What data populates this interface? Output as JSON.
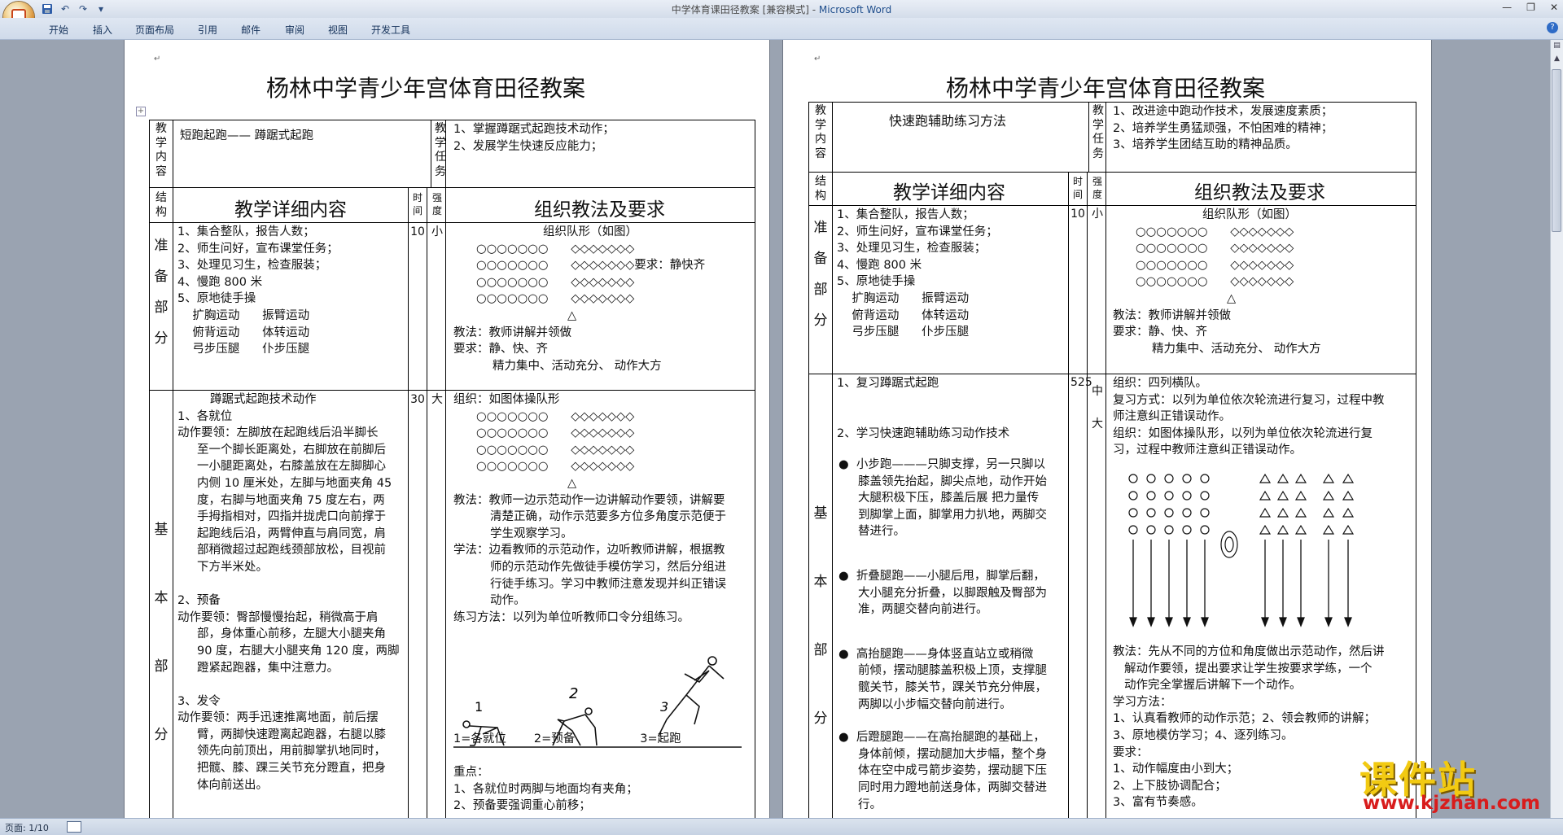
{
  "window": {
    "title_doc": "中学体育课田径教案 [兼容模式] - ",
    "title_app": "Microsoft Word"
  },
  "ribbon_tabs": [
    "开始",
    "插入",
    "页面布局",
    "引用",
    "邮件",
    "审阅",
    "视图",
    "开发工具"
  ],
  "status": {
    "page": "页面: 1/10"
  },
  "watermark": {
    "cn": "课件站",
    "url": "www.kjzhan.com"
  },
  "page1": {
    "title": "杨林中学青少年宫体育田径教案",
    "lbl_content": "教学内容",
    "lbl_task": "教学任务",
    "content": "短跑起跑—— 蹲踞式起跑",
    "tasks": [
      "1、掌握蹲踞式起跑技术动作；",
      "2、发展学生快速反应能力；"
    ],
    "lbl_struct": "结构",
    "hdr_detail": "教学详细内容",
    "lbl_time": "时间",
    "lbl_intensity": "强度",
    "hdr_org": "组织教法及要求",
    "sec1_label": "准备部分",
    "sec1_items": [
      "1、集合整队，报告人数；",
      "2、师生问好，宣布课堂任务；",
      "3、处理见习生，检查服装；",
      "4、慢跑 800 米",
      "5、原地徒手操",
      "    扩胸运动      振臂运动",
      "    俯背运动      体转运动",
      "    弓步压腿      仆步压腿"
    ],
    "sec1_time": "10",
    "sec1_int": "小",
    "sec1_org": [
      "组织队形（如图）",
      "○○○○○○○      ◇◇◇◇◇◇◇",
      "○○○○○○○      ◇◇◇◇◇◇◇要求：静快齐",
      "○○○○○○○      ◇◇◇◇◇◇◇",
      "○○○○○○○      ◇◇◇◇◇◇◇",
      "△",
      "教法：教师讲解并领做",
      "要求：静、快、齐",
      "精力集中、活动充分、  动作大方"
    ],
    "sec2_label": "基本部分",
    "sec2_items": [
      "蹲踞式起跑技术动作",
      "1、各就位",
      "动作要领：左脚放在起跑线后沿半脚长",
      "至一个脚长距离处，右脚放在前脚后",
      "一小腿距离处，右膝盖放在左脚脚心",
      "内侧 10 厘米处，左脚与地面夹角 45",
      "度，右脚与地面夹角 75 度左右，两",
      "手拇指相对，四指并拢虎口向前撑于",
      "起跑线后沿，两臂伸直与肩同宽，肩",
      "部稍微超过起跑线颈部放松，目视前",
      "下方半米处。",
      "",
      "2、预备",
      "动作要领：臀部慢慢抬起，稍微高于肩",
      "部，身体重心前移，左腿大小腿夹角",
      "90 度，右腿大小腿夹角 120 度，两脚",
      "蹬紧起跑器，集中注意力。",
      "",
      "3、发令",
      "动作要领：两手迅速推离地面，前后摆",
      "臂，两脚快速蹬离起跑器，右腿以膝",
      "领先向前顶出，用前脚掌扒地同时，",
      "把髋、膝、踝三关节充分蹬直，把身",
      "体向前送出。"
    ],
    "sec2_time": "30",
    "sec2_int": "大",
    "sec2_org": [
      "组织：如图体操队形",
      "○○○○○○○      ◇◇◇◇◇◇◇",
      "○○○○○○○      ◇◇◇◇◇◇◇",
      "○○○○○○○      ◇◇◇◇◇◇◇",
      "○○○○○○○      ◇◇◇◇◇◇◇",
      "△",
      "教法：教师一边示范动作一边讲解动作要领，讲解要",
      "清楚正确，动作示范要多方位多角度示范便于",
      "学生观察学习。",
      "学法：边看教师的示范动作，边听教师讲解，根据教",
      "师的示范动作先做徒手模仿学习，然后分组进",
      "行徒手练习。学习中教师注意发现并纠正错误",
      "动作。",
      "练习方法：以列为单位听教师口令分组练习。"
    ],
    "fig_nums": [
      "1",
      "2",
      "3"
    ],
    "fig_caption": [
      "1=各就位",
      "2=预备",
      "3=起跑"
    ],
    "points_title": "重点：",
    "points": [
      "1、各就位时两脚与地面均有夹角；",
      "2、预备要强调重心前移；"
    ]
  },
  "page2": {
    "title": "杨林中学青少年宫体育田径教案",
    "lbl_content": "教学内容",
    "lbl_task": "教学任务",
    "content": "快速跑辅助练习方法",
    "tasks": [
      "1、改进途中跑动作技术，发展速度素质；",
      "2、培养学生勇猛顽强，不怕困难的精神；",
      "3、培养学生团结互助的精神品质。"
    ],
    "lbl_struct": "结构",
    "hdr_detail": "教学详细内容",
    "lbl_time": "时间",
    "lbl_intensity": "强度",
    "hdr_org": "组织教法及要求",
    "sec1_label": "准备部分",
    "sec1_items": [
      "1、集合整队，报告人数；",
      "2、师生问好，宣布课堂任务；",
      "3、处理见习生，检查服装；",
      "4、慢跑 800 米",
      "5、原地徒手操",
      "    扩胸运动      振臂运动",
      "    俯背运动      体转运动",
      "    弓步压腿      仆步压腿"
    ],
    "sec1_time": "10",
    "sec1_int": "小",
    "sec1_org": [
      "组织队形（如图）",
      "○○○○○○○      ◇◇◇◇◇◇◇",
      "○○○○○○○      ◇◇◇◇◇◇◇",
      "○○○○○○○      ◇◇◇◇◇◇◇",
      "○○○○○○○      ◇◇◇◇◇◇◇",
      "△",
      "教法：教师讲解并领做",
      "要求：静、快、齐",
      "精力集中、活动充分、  动作大方"
    ],
    "sec2_label": "基本部分",
    "sec2_items_a": [
      "1、复习蹲踞式起跑",
      "",
      "",
      "2、学习快速跑辅助练习动作技术"
    ],
    "bullets": [
      [
        "小步跑———只脚支撑，另一只脚以",
        "膝盖领先抬起，脚尖点地，动作开始",
        "大腿积极下压，膝盖后展  把力量传",
        "到脚掌上面，脚掌用力扒地，两脚交",
        "替进行。"
      ],
      [
        "折叠腿跑——小腿后甩，脚掌后翻，",
        "大小腿充分折叠，以脚跟触及臀部为",
        "准，两腿交替向前进行。"
      ],
      [
        "高抬腿跑——身体竖直站立或稍微",
        "前倾，摆动腿膝盖积极上顶，支撑腿",
        "髋关节，膝关节，踝关节充分伸展，",
        "两脚以小步幅交替向前进行。"
      ],
      [
        "后蹬腿跑——在高抬腿跑的基础上，",
        "身体前倾，摆动腿加大步幅，整个身",
        "体在空中成弓箭步姿势，摆动腿下压",
        "同时用力蹬地前送身体，两脚交替进",
        "行。"
      ]
    ],
    "sec2_time": "525",
    "sec2_int": "中大",
    "sec2_org_a": [
      "组织：四列横队。",
      "复习方式：以列为单位依次轮流进行复习，过程中教",
      "师注意纠正错误动作。",
      "组织：如图体操队形，以列为单位依次轮流进行复",
      "习，过程中教师注意纠正错误动作。"
    ],
    "sec2_org_b": [
      "教法：先从不同的方位和角度做出示范动作，然后讲",
      "解动作要领，提出要求让学生按要求学练，一个",
      "动作完全掌握后讲解下一个动作。",
      "学习方法：",
      "1、认真看教师的动作示范；2、领会教师的讲解；",
      "3、原地模仿学习；4、逐列练习。",
      "要求：",
      "1、动作幅度由小到大；",
      "2、上下肢协调配合；",
      "3、富有节奏感。"
    ]
  }
}
